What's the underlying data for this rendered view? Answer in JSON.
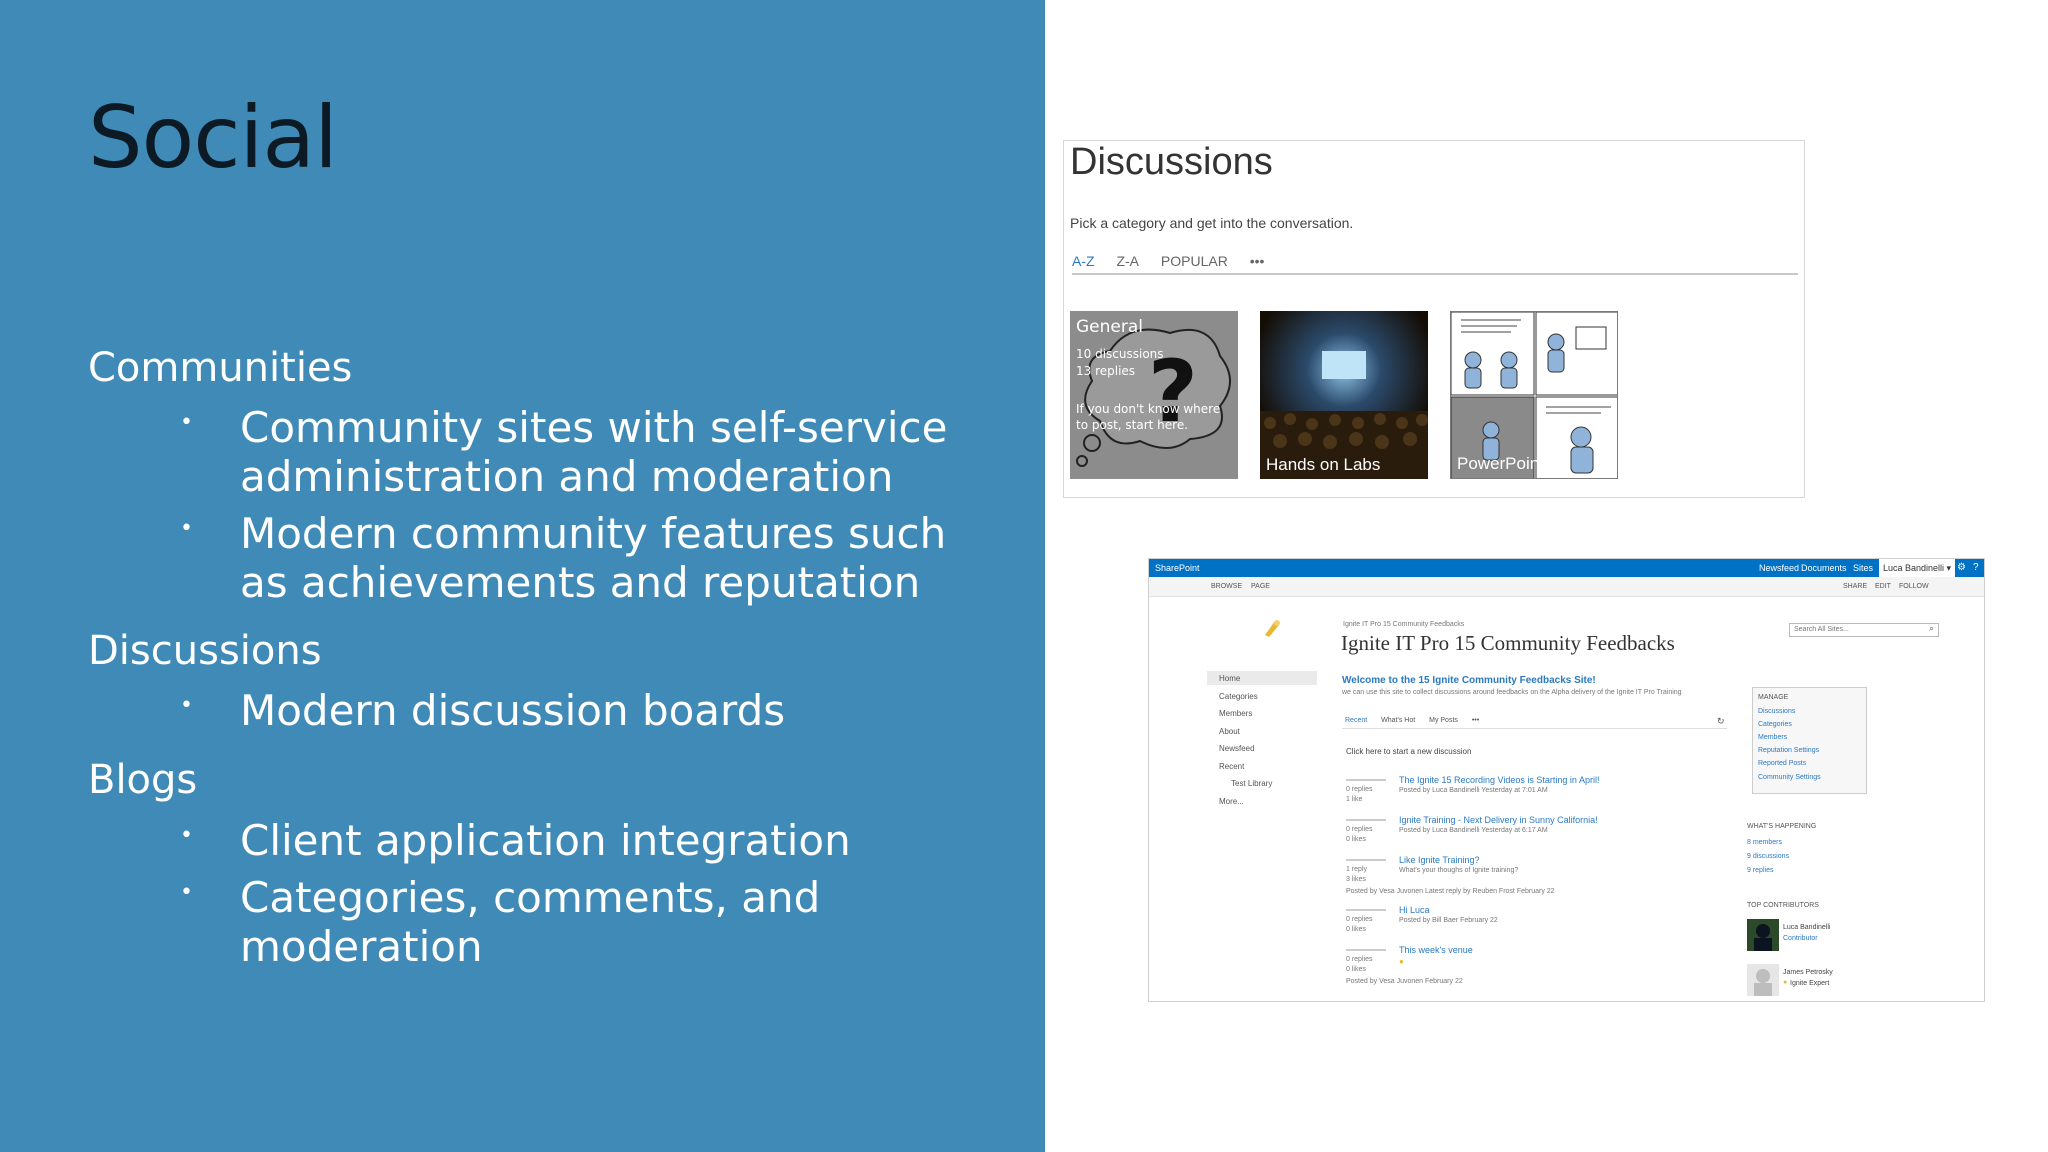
{
  "slide": {
    "title": "Social",
    "sections": [
      {
        "heading": "Communities",
        "bullets": [
          "Community sites with self-service administration and moderation",
          "Modern community features such as achievements and reputation"
        ]
      },
      {
        "heading": "Discussions",
        "bullets": [
          "Modern discussion boards"
        ]
      },
      {
        "heading": "Blogs",
        "bullets": [
          "Client application integration",
          "Categories, comments, and moderation"
        ]
      }
    ],
    "bullet_glyph": "•"
  },
  "discussions_shot": {
    "title": "Discussions",
    "subtitle": "Pick a category and get into the conversation.",
    "tabs": [
      "A-Z",
      "Z-A",
      "POPULAR",
      "•••"
    ],
    "tiles": [
      {
        "label": "General",
        "line1": "10 discussions",
        "line2": "13 replies",
        "note": "If you don't know where to post, start here."
      },
      {
        "label": "Hands on Labs"
      },
      {
        "label": "PowerPoints"
      }
    ]
  },
  "sharepoint_shot": {
    "brand": "SharePoint",
    "top_links": [
      "Newsfeed",
      "Documents",
      "Sites"
    ],
    "user": "Luca Bandinelli ▾",
    "ribbon_tabs": [
      "BROWSE",
      "PAGE"
    ],
    "ribbon_actions": [
      "SHARE",
      "EDIT",
      "FOLLOW"
    ],
    "breadcrumb": "Ignite IT Pro 15 Community Feedbacks",
    "site_title": "Ignite IT Pro 15 Community Feedbacks",
    "search_placeholder": "Search All Sites...",
    "nav": [
      "Home",
      "Categories",
      "Members",
      "About",
      "Newsfeed",
      "Recent",
      "Test Library",
      "More..."
    ],
    "welcome": "Welcome to the 15 Ignite Community Feedbacks Site!",
    "welcome_sub": "we can use this site to collect discussions around feedbacks on the Alpha delivery of the Ignite IT Pro Training",
    "feed_tabs": [
      "Recent",
      "What's Hot",
      "My Posts",
      "•••"
    ],
    "new_prompt": "Click here to start a new discussion",
    "posts": [
      {
        "replies": "0 replies",
        "likes": "1 like",
        "title": "The Ignite 15 Recording Videos is Starting in April!",
        "meta": "Posted by Luca Bandinelli Yesterday at 7:01 AM"
      },
      {
        "replies": "0 replies",
        "likes": "0 likes",
        "title": "Ignite Training - Next Delivery in Sunny California!",
        "meta": "Posted by Luca Bandinelli Yesterday at 6:17 AM"
      },
      {
        "replies": "1 reply",
        "likes": "3 likes",
        "title": "Like Ignite Training?",
        "meta": "What's your thoughs of Ignite training?",
        "meta2": "Posted by Vesa Juvonen  Latest reply by Reuben Frost February 22"
      },
      {
        "replies": "0 replies",
        "likes": "0 likes",
        "title": "Hi Luca",
        "meta": "Posted by Bill Baer February 22"
      },
      {
        "replies": "0 replies",
        "likes": "0 likes",
        "title": "This week's venue",
        "meta": "Posted by Vesa Juvonen February 22"
      }
    ],
    "manage_heading": "MANAGE",
    "manage_links": [
      "Discussions",
      "Categories",
      "Members",
      "Reputation Settings",
      "Reported Posts",
      "Community Settings"
    ],
    "happening_heading": "WHAT'S HAPPENING",
    "happening": [
      "8 members",
      "9 discussions",
      "9 replies"
    ],
    "contributors_heading": "TOP CONTRIBUTORS",
    "contributors": [
      {
        "name": "Luca Bandinelli",
        "role": "Contributor"
      },
      {
        "name": "James Petrosky",
        "role": "Ignite Expert"
      }
    ]
  }
}
